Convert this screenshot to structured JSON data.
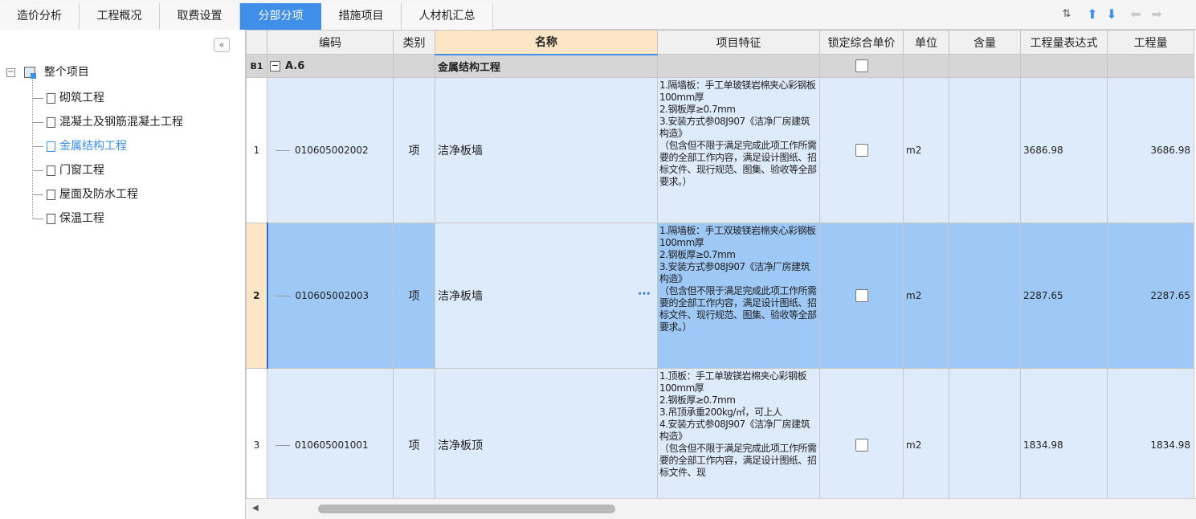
{
  "tabs": [
    {
      "label": "造价分析"
    },
    {
      "label": "工程概况"
    },
    {
      "label": "取费设置"
    },
    {
      "label": "分部分项"
    },
    {
      "label": "措施项目"
    },
    {
      "label": "人材机汇总"
    }
  ],
  "active_tab": "分部分项",
  "toolbar": {
    "icons": [
      "sort-icon",
      "arrow-up-icon",
      "arrow-down-icon",
      "arrow-left-icon",
      "arrow-right-icon"
    ]
  },
  "tree": {
    "root": "整个项目",
    "items": [
      {
        "label": "砌筑工程"
      },
      {
        "label": "混凝土及钢筋混凝土工程"
      },
      {
        "label": "金属结构工程"
      },
      {
        "label": "门窗工程"
      },
      {
        "label": "屋面及防水工程"
      },
      {
        "label": "保温工程"
      }
    ],
    "active_item": "金属结构工程"
  },
  "grid": {
    "columns": [
      "编码",
      "类别",
      "名称",
      "项目特征",
      "锁定综合单价",
      "单位",
      "含量",
      "工程量表达式",
      "工程量"
    ],
    "group": {
      "row_label": "B1",
      "code": "A.6",
      "name": "金属结构工程"
    },
    "rows": [
      {
        "no": "1",
        "code": "010605002002",
        "type": "项",
        "name": "洁净板墙",
        "feature": "1.隔墙板：手工单玻镁岩棉夹心彩钢板100mm厚\n2.钢板厚≥0.7mm\n3.安装方式参08J907《洁净厂房建筑构造》\n（包含但不限于满足完成此项工作所需要的全部工作内容，满足设计图纸、招标文件、现行规范、图集、验收等全部要求。）",
        "unit": "m2",
        "expr": "3686.98",
        "qty": "3686.98"
      },
      {
        "no": "2",
        "code": "010605002003",
        "type": "项",
        "name": "洁净板墙",
        "feature": "1.隔墙板：手工双玻镁岩棉夹心彩钢板100mm厚\n2.钢板厚≥0.7mm\n3.安装方式参08J907《洁净厂房建筑构造》\n（包含但不限于满足完成此项工作所需要的全部工作内容，满足设计图纸、招标文件、现行规范、图集、验收等全部要求。）",
        "unit": "m2",
        "expr": "2287.65",
        "qty": "2287.65"
      },
      {
        "no": "3",
        "code": "010605001001",
        "type": "项",
        "name": "洁净板顶",
        "feature": "1.顶板：手工单玻镁岩棉夹心彩钢板100mm厚\n2.钢板厚≥0.7mm\n3.吊顶承重200kg/㎡，可上人\n4.安装方式参08J907《洁净厂房建筑构造》\n（包含但不限于满足完成此项工作所需要的全部工作内容，满足设计图纸、招标文件、现",
        "unit": "m2",
        "expr": "1834.98",
        "qty": "1834.98"
      }
    ]
  },
  "colors": {
    "accent": "#3f8ee8",
    "row_bg": "#deebfb",
    "row_selected": "#9ec8f6",
    "header_sorted": "#fde6c6",
    "group_bg": "#d6d6d6"
  }
}
